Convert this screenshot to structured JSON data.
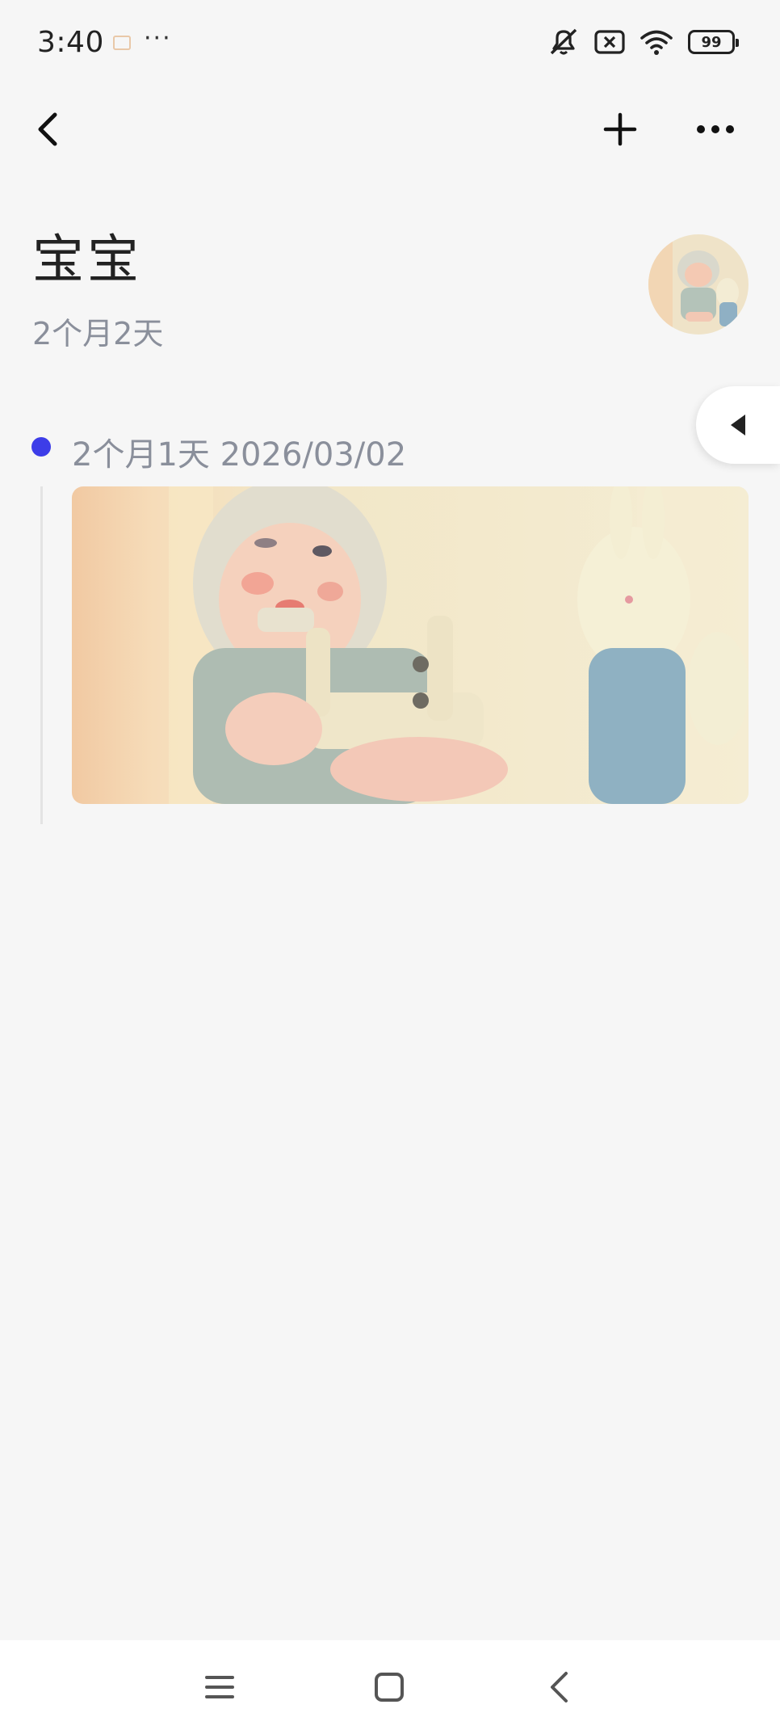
{
  "status_bar": {
    "time": "3:40",
    "more": "···",
    "battery_level": "99",
    "icons": [
      "app-notification-icon",
      "mute-icon",
      "no-sim-icon",
      "wifi-icon",
      "battery-icon"
    ]
  },
  "toolbar": {
    "back_icon": "chevron-left-icon",
    "add_icon": "plus-icon",
    "more_icon": "more-horizontal-icon"
  },
  "profile": {
    "name": "宝宝",
    "age": "2个月2天",
    "avatar": "baby-avatar"
  },
  "side_tab": {
    "icon": "caret-left-icon"
  },
  "timeline": {
    "entries": [
      {
        "label": "2个月1天 2026/03/02",
        "photo": "baby-with-bunny-photo"
      }
    ]
  },
  "nav_bar": {
    "icons": [
      "menu-icon",
      "home-square-icon",
      "back-chevron-icon"
    ]
  },
  "colors": {
    "background": "#f6f6f6",
    "timeline_dot": "#3d3de8",
    "secondary_text": "#8a8f9b"
  }
}
